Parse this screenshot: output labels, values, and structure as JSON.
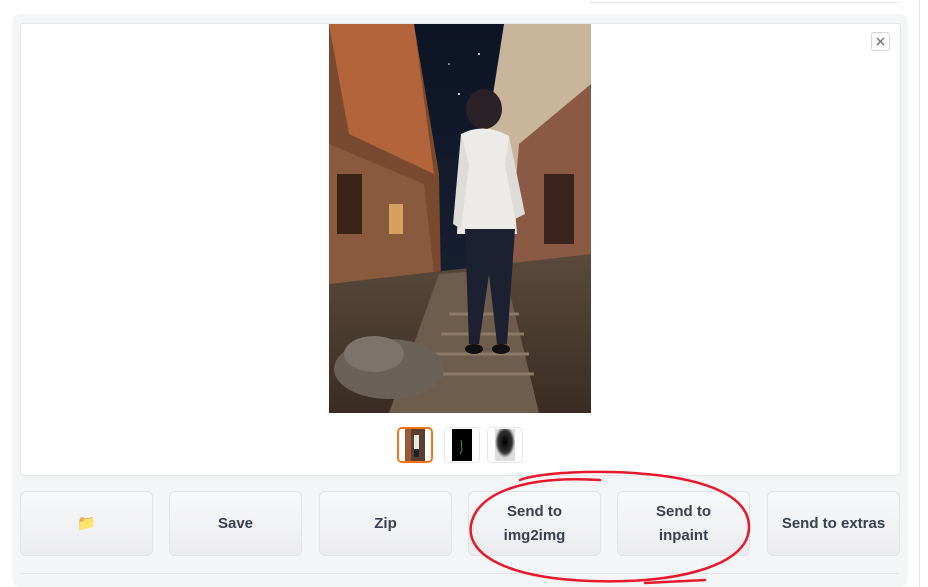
{
  "gallery": {
    "close_icon": "close-icon",
    "selected_thumbnail": 1,
    "thumbnail_count": 3
  },
  "buttons": {
    "folder_icon": "📁",
    "save": "Save",
    "zip": "Zip",
    "send_img2img": "Send to\nimg2img",
    "send_inpaint": "Send to\ninpaint",
    "send_extras": "Send to extras"
  },
  "colors": {
    "selected_thumb_border": "#f97316",
    "annotation_stroke": "#e8192c",
    "button_text": "#374151"
  }
}
